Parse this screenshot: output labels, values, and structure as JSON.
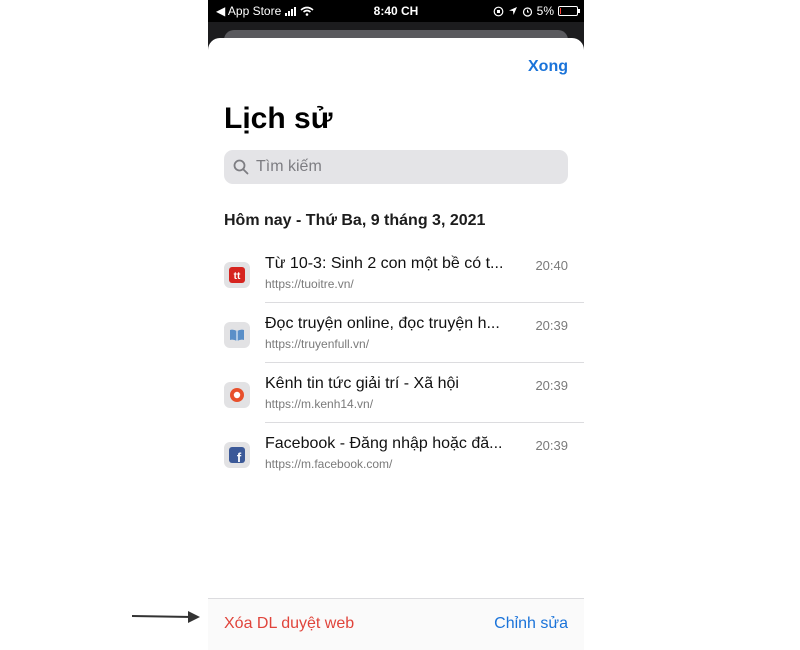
{
  "status_bar": {
    "back_app": "◀ App Store",
    "time": "8:40 CH",
    "battery": "5%",
    "battery_level": 0.05
  },
  "header": {
    "done_label": "Xong",
    "title": "Lịch sử"
  },
  "search": {
    "placeholder": "Tìm kiếm"
  },
  "section": {
    "title": "Hôm nay - Thứ Ba, 9 tháng 3, 2021"
  },
  "history": [
    {
      "title": "Từ 10-3: Sinh 2 con một bề có t...",
      "url": "https://tuoitre.vn/",
      "time": "20:40",
      "icon": "tuoitre-icon"
    },
    {
      "title": "Đọc truyện online, đọc truyện h...",
      "url": "https://truyenfull.vn/",
      "time": "20:39",
      "icon": "book-icon"
    },
    {
      "title": "Kênh tin tức giải trí - Xã hội",
      "url": "https://m.kenh14.vn/",
      "time": "20:39",
      "icon": "kenh14-icon"
    },
    {
      "title": "Facebook - Đăng nhập hoặc đă...",
      "url": "https://m.facebook.com/",
      "time": "20:39",
      "icon": "facebook-icon"
    }
  ],
  "toolbar": {
    "clear_label": "Xóa DL duyệt web",
    "edit_label": "Chỉnh sửa"
  },
  "colors": {
    "accent": "#1a73d9",
    "destructive": "#e0443b"
  }
}
